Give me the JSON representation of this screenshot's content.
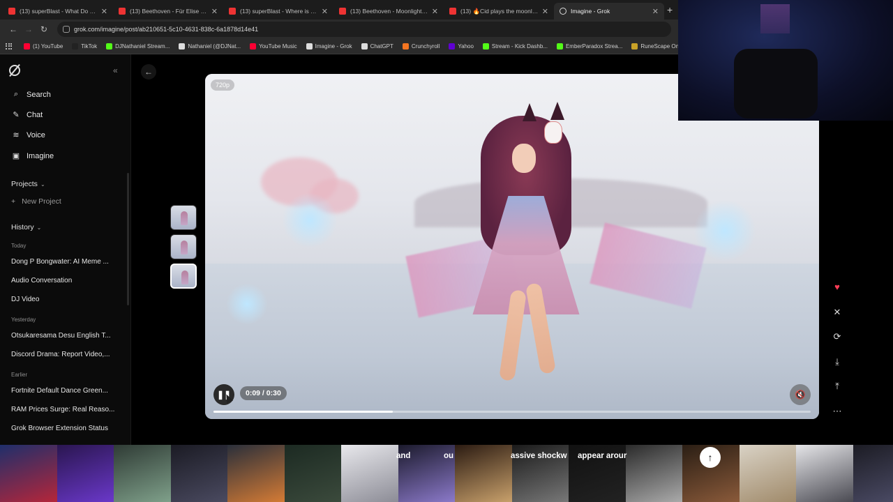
{
  "browser": {
    "tabs": [
      {
        "title": "(13) superBlast - What Do You",
        "favicon": "youtube-icon"
      },
      {
        "title": "(13) Beethoven - Für Elise - You",
        "favicon": "youtube-icon"
      },
      {
        "title": "(13) superBlast - Where is Your",
        "favicon": "youtube-icon"
      },
      {
        "title": "(13) Beethoven - Moonlight So",
        "favicon": "youtube-icon"
      },
      {
        "title": "(13) 🔥Cid plays the moonlight",
        "favicon": "youtube-icon"
      },
      {
        "title": "Imagine - Grok",
        "favicon": "grok-icon"
      }
    ],
    "url": "grok.com/imagine/post/ab210651-5c10-4631-838c-6a1878d14e41",
    "bookmarks": [
      {
        "label": "(1) YouTube",
        "color": "#ff0033"
      },
      {
        "label": "TikTok",
        "color": "#222222"
      },
      {
        "label": "DJNathaniel Stream...",
        "color": "#53fc18"
      },
      {
        "label": "Nathaniel (@DJNat...",
        "color": "#dddddd"
      },
      {
        "label": "YouTube Music",
        "color": "#ff0033"
      },
      {
        "label": "Imagine - Grok",
        "color": "#dddddd"
      },
      {
        "label": "ChatGPT",
        "color": "#dddddd"
      },
      {
        "label": "Crunchyroll",
        "color": "#f47521"
      },
      {
        "label": "Yahoo",
        "color": "#6001d2"
      },
      {
        "label": "Stream - Kick Dashb...",
        "color": "#53fc18"
      },
      {
        "label": "EmberParadox Strea...",
        "color": "#53fc18"
      },
      {
        "label": "RuneScape Online",
        "color": "#c9a227"
      }
    ]
  },
  "sidebar": {
    "nav": [
      {
        "label": "Search",
        "icon": "search-icon",
        "glyph": "⌕"
      },
      {
        "label": "Chat",
        "icon": "chat-icon",
        "glyph": "✎"
      },
      {
        "label": "Voice",
        "icon": "voice-icon",
        "glyph": "≋"
      },
      {
        "label": "Imagine",
        "icon": "image-icon",
        "glyph": "▣"
      }
    ],
    "projects_label": "Projects",
    "new_project_label": "New Project",
    "history_label": "History",
    "groups": {
      "today": "Today",
      "yesterday": "Yesterday",
      "earlier": "Earlier"
    },
    "history_today": [
      "Dong P Bongwater: AI Meme ...",
      "Audio Conversation",
      "DJ Video"
    ],
    "history_yesterday": [
      "Otsukaresama Desu English T...",
      "Discord Drama: Report Video,..."
    ],
    "history_earlier": [
      "Fortnite Default Dance Green...",
      "RAM Prices Surge: Real Reaso...",
      "Grok Browser Extension Status"
    ]
  },
  "player": {
    "resolution": "720p",
    "time": "0:09 / 0:30",
    "progress": 0.3,
    "state": "playing",
    "muted": true
  },
  "bottom_strip": {
    "caption_1": "and",
    "caption_2": "ou",
    "caption_3": "assive shockw",
    "caption_4": "appear arour"
  },
  "colors": {
    "accent_heart": "#ff3d57",
    "background": "#000000"
  }
}
